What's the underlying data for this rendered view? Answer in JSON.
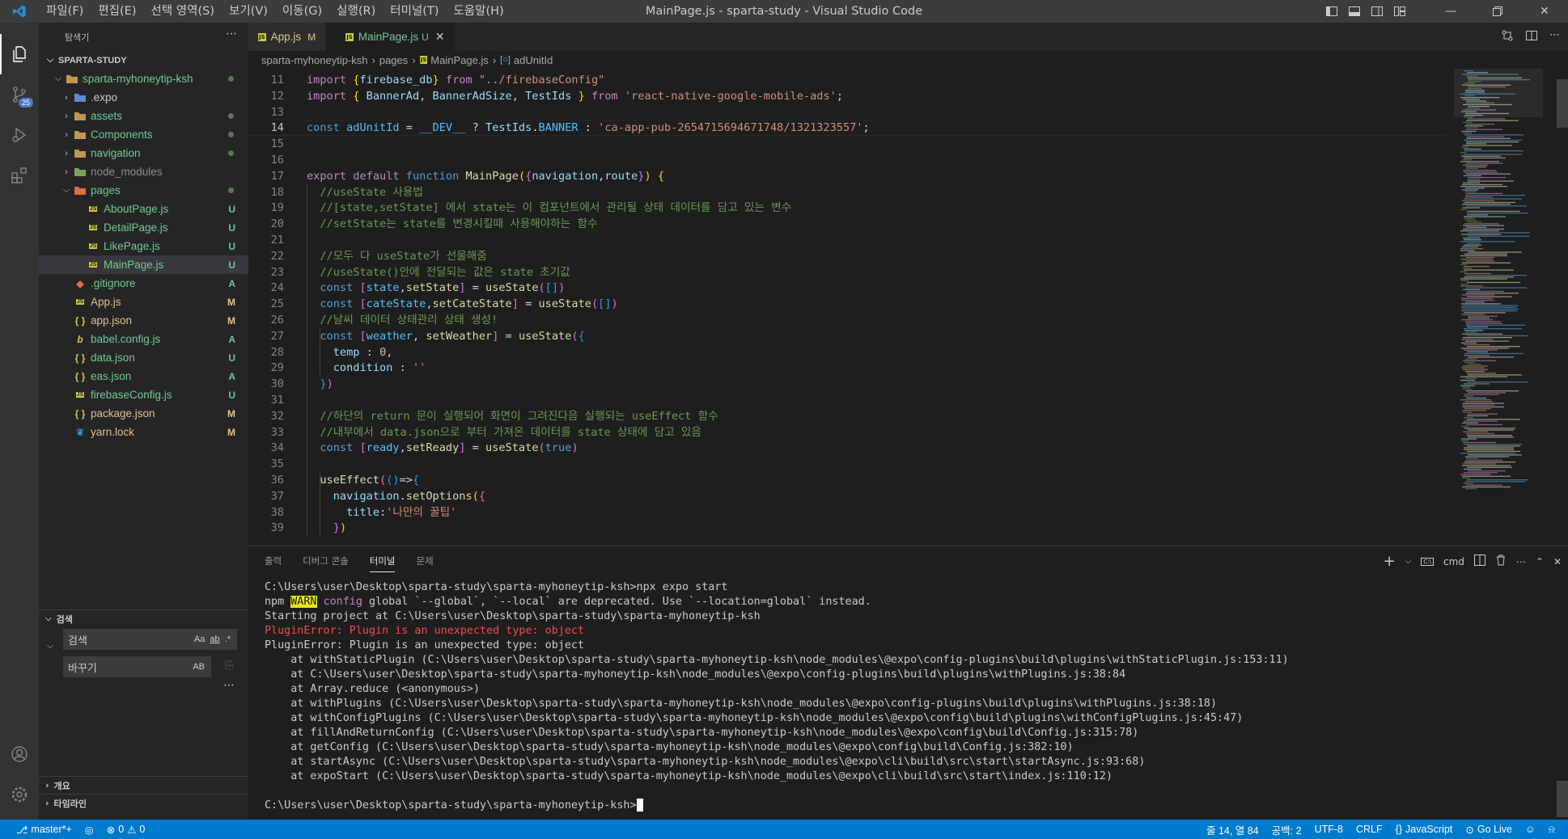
{
  "window": {
    "title": "MainPage.js - sparta-study - Visual Studio Code",
    "menu": [
      "파일(F)",
      "편집(E)",
      "선택 영역(S)",
      "보기(V)",
      "이동(G)",
      "실행(R)",
      "터미널(T)",
      "도움말(H)"
    ]
  },
  "activity": {
    "scm_badge": "25"
  },
  "explorer": {
    "header": "탐색기",
    "root": "SPARTA-STUDY",
    "items": [
      {
        "label": "sparta-myhoneytip-ksh",
        "status": "",
        "dot": true
      },
      {
        "label": ".expo",
        "status": ""
      },
      {
        "label": "assets",
        "status": "",
        "dot": true
      },
      {
        "label": "Components",
        "status": "",
        "dot": true
      },
      {
        "label": "navigation",
        "status": "",
        "dot": true
      },
      {
        "label": "node_modules",
        "status": ""
      },
      {
        "label": "pages",
        "status": "",
        "dot": true
      },
      {
        "label": "AboutPage.js",
        "status": "U"
      },
      {
        "label": "DetailPage.js",
        "status": "U"
      },
      {
        "label": "LikePage.js",
        "status": "U"
      },
      {
        "label": "MainPage.js",
        "status": "U"
      },
      {
        "label": ".gitignore",
        "status": "A"
      },
      {
        "label": "App.js",
        "status": "M"
      },
      {
        "label": "app.json",
        "status": "M"
      },
      {
        "label": "babel.config.js",
        "status": "A"
      },
      {
        "label": "data.json",
        "status": "U"
      },
      {
        "label": "eas.json",
        "status": "A"
      },
      {
        "label": "firebaseConfig.js",
        "status": "U"
      },
      {
        "label": "package.json",
        "status": "M"
      },
      {
        "label": "yarn.lock",
        "status": "M"
      }
    ]
  },
  "search": {
    "header": "검색",
    "search_placeholder": "검색",
    "replace_placeholder": "바꾸기",
    "opts": [
      "Aa",
      "ab",
      ".*"
    ],
    "replace_opt": "AB"
  },
  "outline": {
    "outline_label": "개요",
    "timeline_label": "타임라인"
  },
  "tabs": [
    {
      "label": "App.js",
      "mod": "M"
    },
    {
      "label": "MainPage.js",
      "mod": "U"
    }
  ],
  "breadcrumbs": [
    "sparta-myhoneytip-ksh",
    "pages",
    "MainPage.js",
    "adUnitId"
  ],
  "editor": {
    "lines": [
      {
        "n": "11",
        "html": "<span class=\"k\">import</span> <span class=\"br1\">{</span><span class=\"v\">firebase_db</span><span class=\"br1\">}</span> <span class=\"k\">from</span> <span class=\"s\">\"../firebaseConfig\"</span>"
      },
      {
        "n": "12",
        "html": "<span class=\"k\">import</span> <span class=\"br1\">{</span> <span class=\"v\">BannerAd</span>, <span class=\"v\">BannerAdSize</span>, <span class=\"v\">TestIds</span> <span class=\"br1\">}</span> <span class=\"k\">from</span> <span class=\"s\">'react-native-google-mobile-ads'</span>;"
      },
      {
        "n": "13",
        "html": ""
      },
      {
        "n": "14",
        "html": "<span class=\"b\">const</span> <span class=\"c\">adUnitId</span> = <span class=\"c\">__DEV__</span> ? <span class=\"v\">TestIds</span>.<span class=\"c\">BANNER</span> : <span class=\"s\">'ca-app-pub-2654715694671748/1321323557'</span>;"
      },
      {
        "n": "15",
        "html": ""
      },
      {
        "n": "16",
        "html": ""
      },
      {
        "n": "17",
        "html": "<span class=\"k\">export</span> <span class=\"k\">default</span> <span class=\"b\">function</span> <span class=\"f\">MainPage</span><span class=\"br1\">(</span><span class=\"br2\">{</span><span class=\"v\">navigation</span>,<span class=\"v\">route</span><span class=\"br2\">}</span><span class=\"br1\">)</span> <span class=\"br1\">{</span>"
      },
      {
        "n": "18",
        "html": "  <span class=\"cm\">//useState 사용법</span>"
      },
      {
        "n": "19",
        "html": "  <span class=\"cm\">//[state,setState] 에서 state는 이 컴포넌트에서 관리될 상태 데이터를 담고 있는 변수</span>"
      },
      {
        "n": "20",
        "html": "  <span class=\"cm\">//setState는 state를 변경시킬때 사용해야하는 함수</span>"
      },
      {
        "n": "21",
        "html": ""
      },
      {
        "n": "22",
        "html": "  <span class=\"cm\">//모두 다 useState가 선물해줌</span>"
      },
      {
        "n": "23",
        "html": "  <span class=\"cm\">//useState()안에 전달되는 값은 state 초기값</span>"
      },
      {
        "n": "24",
        "html": "  <span class=\"b\">const</span> <span class=\"br2\">[</span><span class=\"c\">state</span>,<span class=\"f\">setState</span><span class=\"br2\">]</span> = <span class=\"f\">useState</span><span class=\"br2\">(</span><span class=\"br3\">[]</span><span class=\"br2\">)</span>"
      },
      {
        "n": "25",
        "html": "  <span class=\"b\">const</span> <span class=\"br2\">[</span><span class=\"c\">cateState</span>,<span class=\"f\">setCateState</span><span class=\"br2\">]</span> = <span class=\"f\">useState</span><span class=\"br2\">(</span><span class=\"br3\">[]</span><span class=\"br2\">)</span>"
      },
      {
        "n": "26",
        "html": "  <span class=\"cm\">//날씨 데이터 상태관리 상태 생성!</span>"
      },
      {
        "n": "27",
        "html": "  <span class=\"b\">const</span> <span class=\"br2\">[</span><span class=\"c\">weather</span>, <span class=\"f\">setWeather</span><span class=\"br2\">]</span> = <span class=\"f\">useState</span><span class=\"br2\">(</span><span class=\"br3\">{</span>"
      },
      {
        "n": "28",
        "html": "    <span class=\"v\">temp</span> : <span class=\"n\">0</span>,"
      },
      {
        "n": "29",
        "html": "    <span class=\"v\">condition</span> : <span class=\"s\">''</span>"
      },
      {
        "n": "30",
        "html": "  <span class=\"br3\">}</span><span class=\"br2\">)</span>"
      },
      {
        "n": "31",
        "html": ""
      },
      {
        "n": "32",
        "html": "  <span class=\"cm\">//하단의 return 문이 실행되어 화면이 그려진다음 실행되는 useEffect 함수</span>"
      },
      {
        "n": "33",
        "html": "  <span class=\"cm\">//내부에서 data.json으로 부터 가져온 데이터를 state 상태에 담고 있음</span>"
      },
      {
        "n": "34",
        "html": "  <span class=\"b\">const</span> <span class=\"br2\">[</span><span class=\"c\">ready</span>,<span class=\"f\">setReady</span><span class=\"br2\">]</span> = <span class=\"f\">useState</span><span class=\"br2\">(</span><span class=\"b\">true</span><span class=\"br2\">)</span>"
      },
      {
        "n": "35",
        "html": ""
      },
      {
        "n": "36",
        "html": "  <span class=\"f\">useEffect</span><span class=\"br2\">(</span><span class=\"br3\">()</span>=&gt;<span class=\"br3\">{</span>"
      },
      {
        "n": "37",
        "html": "    <span class=\"v\">navigation</span>.<span class=\"f\">setOptions</span><span class=\"br1\">(</span><span class=\"br2\">{</span>"
      },
      {
        "n": "38",
        "html": "      <span class=\"v\">title</span>:<span class=\"s\">'나만의 꿀팁'</span>"
      },
      {
        "n": "39",
        "html": "    <span class=\"br2\">}</span><span class=\"br1\">)</span>"
      }
    ]
  },
  "panel": {
    "tabs": [
      "출력",
      "디버그 콘솔",
      "터미널",
      "문제"
    ],
    "shell": "cmd",
    "terminal": [
      {
        "text": "C:\\Users\\user\\Desktop\\sparta-study\\sparta-myhoneytip-ksh>npx expo start",
        "cls": ""
      },
      {
        "text": "__WARN__",
        "cls": ""
      },
      {
        "text": "Starting project at C:\\Users\\user\\Desktop\\sparta-study\\sparta-myhoneytip-ksh",
        "cls": "trace"
      },
      {
        "text": "PluginError: Plugin is an unexpected type: object",
        "cls": "err"
      },
      {
        "text": "PluginError: Plugin is an unexpected type: object",
        "cls": "trace"
      },
      {
        "text": "    at withStaticPlugin (C:\\Users\\user\\Desktop\\sparta-study\\sparta-myhoneytip-ksh\\node_modules\\@expo\\config-plugins\\build\\plugins\\withStaticPlugin.js:153:11)",
        "cls": "trace"
      },
      {
        "text": "    at C:\\Users\\user\\Desktop\\sparta-study\\sparta-myhoneytip-ksh\\node_modules\\@expo\\config-plugins\\build\\plugins\\withPlugins.js:38:84",
        "cls": "trace"
      },
      {
        "text": "    at Array.reduce (<anonymous>)",
        "cls": "trace"
      },
      {
        "text": "    at withPlugins (C:\\Users\\user\\Desktop\\sparta-study\\sparta-myhoneytip-ksh\\node_modules\\@expo\\config-plugins\\build\\plugins\\withPlugins.js:38:18)",
        "cls": "trace"
      },
      {
        "text": "    at withConfigPlugins (C:\\Users\\user\\Desktop\\sparta-study\\sparta-myhoneytip-ksh\\node_modules\\@expo\\config\\build\\plugins\\withConfigPlugins.js:45:47)",
        "cls": "trace"
      },
      {
        "text": "    at fillAndReturnConfig (C:\\Users\\user\\Desktop\\sparta-study\\sparta-myhoneytip-ksh\\node_modules\\@expo\\config\\build\\Config.js:315:78)",
        "cls": "trace"
      },
      {
        "text": "    at getConfig (C:\\Users\\user\\Desktop\\sparta-study\\sparta-myhoneytip-ksh\\node_modules\\@expo\\config\\build\\Config.js:382:10)",
        "cls": "trace"
      },
      {
        "text": "    at startAsync (C:\\Users\\user\\Desktop\\sparta-study\\sparta-myhoneytip-ksh\\node_modules\\@expo\\cli\\build\\src\\start\\startAsync.js:93:68)",
        "cls": "trace"
      },
      {
        "text": "    at expoStart (C:\\Users\\user\\Desktop\\sparta-study\\sparta-myhoneytip-ksh\\node_modules\\@expo\\cli\\build\\src\\start\\index.js:110:12)",
        "cls": "trace"
      },
      {
        "text": "",
        "cls": ""
      },
      {
        "text": "C:\\Users\\user\\Desktop\\sparta-study\\sparta-myhoneytip-ksh>",
        "cls": "prompt"
      }
    ],
    "warn_line": {
      "pre": "npm ",
      "warn": "WARN",
      "cfg": "config",
      "rest": " global `--global`, `--local` are deprecated. Use `--location=global` instead."
    }
  },
  "status": {
    "branch": "master*+",
    "errors": "0",
    "warnings": "0",
    "position": "줄 14, 열 84",
    "spaces": "공백: 2",
    "encoding": "UTF-8",
    "eol": "CRLF",
    "language": "JavaScript",
    "golive": "Go Live"
  },
  "colors": {
    "accent": "#007acc",
    "untracked": "#73c991",
    "modified": "#e2c08d"
  }
}
